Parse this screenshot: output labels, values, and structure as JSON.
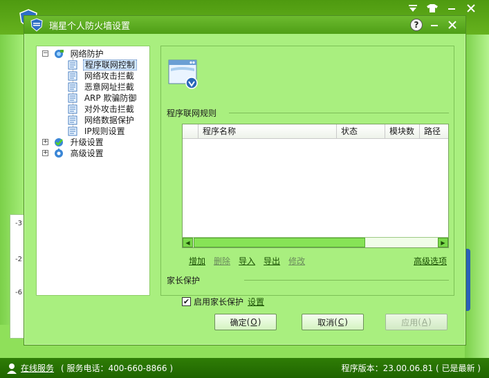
{
  "dialog": {
    "title": "瑞星个人防火墙设置",
    "help": "?",
    "minimize_glyph": "—",
    "close_glyph": "✕"
  },
  "tree": {
    "groups": [
      {
        "label": "网络防护",
        "expander": "−",
        "icon": "network-protection-icon",
        "children": [
          "程序联网控制",
          "网络攻击拦截",
          "恶意网址拦截",
          "ARP 欺骗防御",
          "对外攻击拦截",
          "网络数据保护",
          "IP规则设置"
        ],
        "selected": "程序联网控制"
      },
      {
        "label": "升级设置",
        "expander": "+",
        "icon": "upgrade-check-icon"
      },
      {
        "label": "高级设置",
        "expander": "+",
        "icon": "gear-globe-icon"
      }
    ]
  },
  "content": {
    "section_rules_title": "程序联网规则",
    "table": {
      "columns": [
        "",
        "程序名称",
        "状态",
        "模块数",
        "路径"
      ],
      "rows": []
    },
    "actions": [
      {
        "label": "增加",
        "enabled": true
      },
      {
        "label": "删除",
        "enabled": false
      },
      {
        "label": "导入",
        "enabled": true
      },
      {
        "label": "导出",
        "enabled": true
      },
      {
        "label": "修改",
        "enabled": false
      }
    ],
    "advanced_link": "高级选项",
    "section_parent_title": "家长保护",
    "parent_checkbox_label": "启用家长保护",
    "parent_checkbox_checked": true,
    "parent_settings_link": "设置"
  },
  "buttons": {
    "ok_label": "确定",
    "ok_key": "O",
    "cancel_label": "取消",
    "cancel_key": "C",
    "apply_label": "应用",
    "apply_key": "A"
  },
  "statusbar": {
    "online_service": "在线服务",
    "phone": "( 服务电话：400-660-8866 )",
    "version": "程序版本：23.00.06.81 ( 已是最新 )"
  },
  "background": {
    "side_ticks": [
      "-3",
      "-2",
      "-6"
    ]
  },
  "colors": {
    "dialog_bg": "#a9ef7f",
    "title_green": "#4e9e16",
    "status_green": "#1f6400",
    "link_green": "#174d00"
  }
}
